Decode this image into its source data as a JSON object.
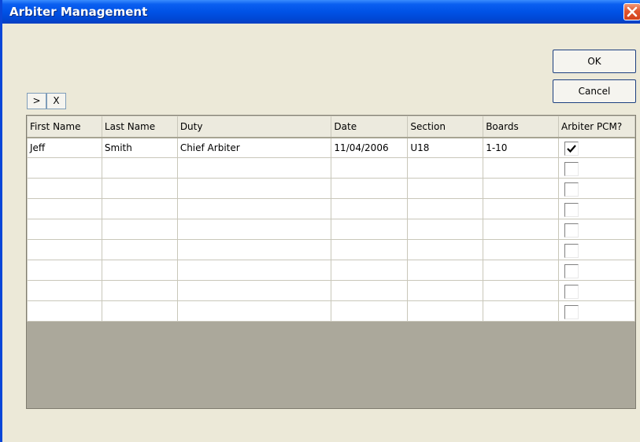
{
  "window": {
    "title": "Arbiter Management"
  },
  "buttons": {
    "ok": "OK",
    "cancel": "Cancel",
    "add": ">",
    "remove": "X"
  },
  "table": {
    "columns": [
      "First Name",
      "Last Name",
      "Duty",
      "Date",
      "Section",
      "Boards",
      "Arbiter PCM?"
    ],
    "rows": [
      {
        "first": "Jeff",
        "last": "Smith",
        "duty": "Chief Arbiter",
        "date": "11/04/2006",
        "section": "U18",
        "boards": "1-10",
        "pcm": true
      },
      {
        "first": "",
        "last": "",
        "duty": "",
        "date": "",
        "section": "",
        "boards": "",
        "pcm": false
      },
      {
        "first": "",
        "last": "",
        "duty": "",
        "date": "",
        "section": "",
        "boards": "",
        "pcm": false
      },
      {
        "first": "",
        "last": "",
        "duty": "",
        "date": "",
        "section": "",
        "boards": "",
        "pcm": false
      },
      {
        "first": "",
        "last": "",
        "duty": "",
        "date": "",
        "section": "",
        "boards": "",
        "pcm": false
      },
      {
        "first": "",
        "last": "",
        "duty": "",
        "date": "",
        "section": "",
        "boards": "",
        "pcm": false
      },
      {
        "first": "",
        "last": "",
        "duty": "",
        "date": "",
        "section": "",
        "boards": "",
        "pcm": false
      },
      {
        "first": "",
        "last": "",
        "duty": "",
        "date": "",
        "section": "",
        "boards": "",
        "pcm": false
      },
      {
        "first": "",
        "last": "",
        "duty": "",
        "date": "",
        "section": "",
        "boards": "",
        "pcm": false
      }
    ]
  },
  "icons": {
    "close": "close-icon",
    "check": "checkmark-icon"
  },
  "colors": {
    "titlebar": "#0052e6",
    "window_bg": "#ece9d8",
    "close": "#e0552e",
    "grid_empty": "#aba89b"
  }
}
